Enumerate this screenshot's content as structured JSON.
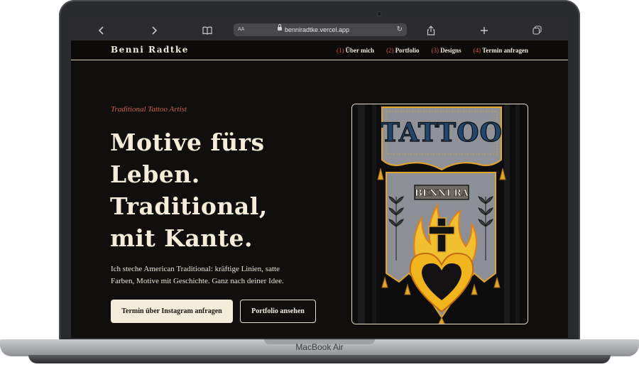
{
  "device": {
    "label": "MacBook Air"
  },
  "browser": {
    "url_text_size": "AA",
    "url": "benniradtke.vercel.app",
    "icons": [
      "chevron-left-icon",
      "chevron-right-icon",
      "book-icon",
      "lock-icon",
      "reload-icon",
      "share-icon",
      "plus-icon",
      "tabs-icon"
    ]
  },
  "site": {
    "brand": "Benni Radtke",
    "nav": [
      {
        "num": "(1)",
        "label": "Über mich"
      },
      {
        "num": "(2)",
        "label": "Portfolio"
      },
      {
        "num": "(3)",
        "label": "Designs"
      },
      {
        "num": "(4)",
        "label": "Termin anfragen"
      }
    ]
  },
  "hero": {
    "kicker": "Traditional Tattoo Artist",
    "headline_lines": [
      "Motive fürs",
      "Leben.",
      "Traditional,",
      "mit Kante."
    ],
    "lead": "Ich steche American Traditional: kräftige Linien, satte Farben, Motive mit Geschichte. Ganz nach deiner Idee.",
    "cta_primary": "Termin über Instagram anfragen",
    "cta_secondary": "Portfolio ansehen"
  },
  "banner": {
    "title": "TATTOO",
    "subtitle": "BENNI RA"
  },
  "colors": {
    "accent": "#d9574a",
    "cream": "#f4ecda",
    "background": "#100f0e",
    "banner_gold": "#e2a52a",
    "banner_felt": "#8f9399"
  }
}
